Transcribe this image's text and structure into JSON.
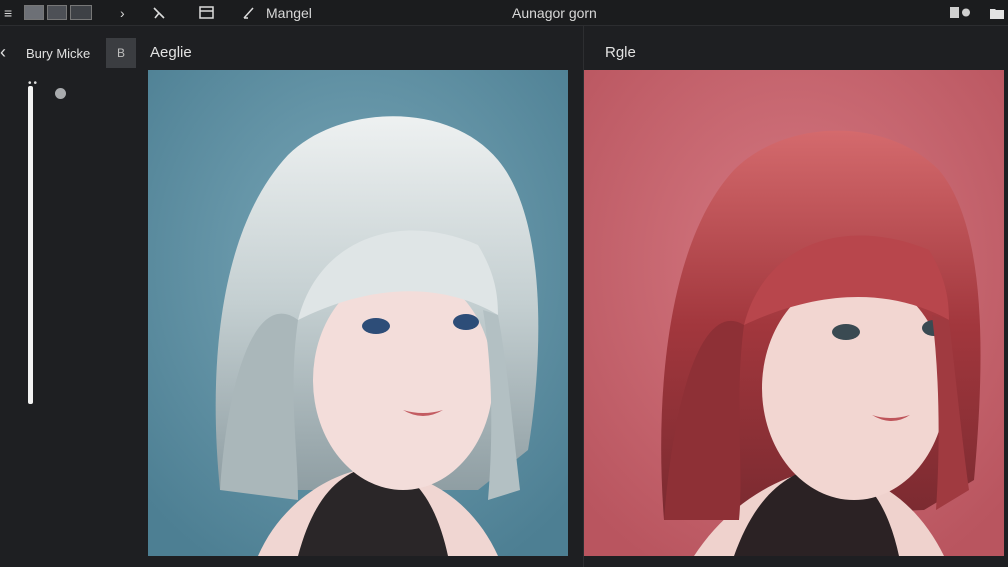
{
  "toolbar": {
    "menu_glyph": "≡",
    "nav_chevron": "›",
    "brush_glyph": "✲",
    "mode_label": "Mangel",
    "window_title": "Aunagor gorn",
    "icons": [
      "thumbnail-strip-icon",
      "chevron-right-icon",
      "wand-icon",
      "frame-icon",
      "pencil-icon",
      "view-toggle-icon",
      "eye-icon",
      "folder-icon"
    ]
  },
  "sidebar": {
    "back_glyph": "‹",
    "title": "Bury Micke",
    "button_label": "B",
    "dots": "••"
  },
  "panels": {
    "left_label": "Aeglie",
    "right_label": "Rgle"
  },
  "colors": {
    "left_background": "#5a8ea3",
    "right_background": "#c86772",
    "left_hair": "#c9d3d6",
    "right_hair": "#a8353b"
  }
}
